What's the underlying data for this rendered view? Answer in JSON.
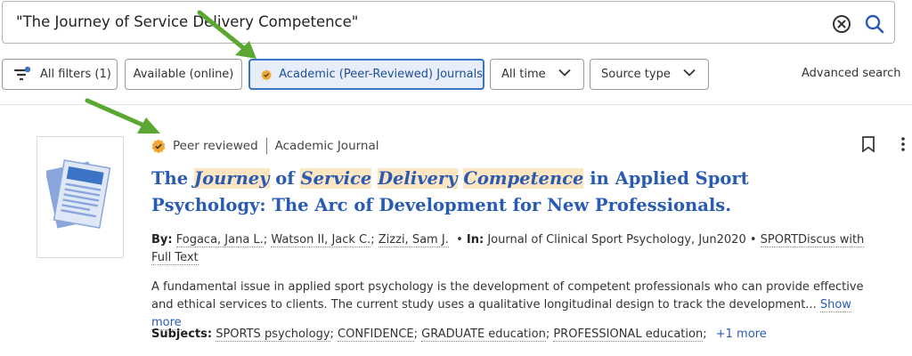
{
  "search": {
    "query": "\"The Journey of Service Delivery Competence\""
  },
  "filters": {
    "all_filters": "All filters (1)",
    "available": "Available (online)",
    "academic": "Academic (Peer-Reviewed) Journals",
    "time": "All time",
    "source_type": "Source type",
    "advanced": "Advanced search"
  },
  "result": {
    "peer_reviewed": "Peer reviewed",
    "doc_type": "Academic Journal",
    "title_parts": [
      "The ",
      "Journey",
      " of ",
      "Service",
      " ",
      "Delivery",
      " ",
      "Competence",
      " in Applied Sport Psychology: The Arc of Development for New Professionals."
    ],
    "by_label": "By:",
    "authors": [
      "Fogaca, Jana L.",
      "Watson II, Jack C.",
      "Zizzi, Sam J."
    ],
    "in_label": "In:",
    "source": "Journal of Clinical Sport Psychology, Jun2020",
    "database": "SPORTDiscus with Full Text",
    "abstract": "A fundamental issue in applied sport psychology is the development of competent professionals who can provide effective and ethical services to clients. The current study uses a qualitative longitudinal design to track the development...",
    "show_more": "Show more",
    "subjects_label": "Subjects:",
    "subjects": [
      "SPORTS psychology",
      "CONFIDENCE",
      "GRADUATE education",
      "PROFESSIONAL education"
    ],
    "more_subjects": "+1 more"
  },
  "colors": {
    "link": "#2a5bb2",
    "highlight": "#fde6c2",
    "badge": "#f0a830",
    "annotation_arrow": "#5aa832"
  },
  "icons": [
    "close-circle-icon",
    "search-icon",
    "filter-icon",
    "peer-reviewed-badge-icon",
    "chevron-down-icon",
    "document-icon",
    "bookmark-icon",
    "more-vertical-icon"
  ]
}
